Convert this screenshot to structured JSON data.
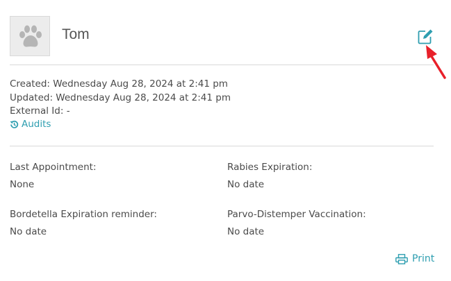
{
  "pet": {
    "name": "Tom",
    "avatar_icon": "paw-print-icon"
  },
  "header": {
    "edit_icon": "edit-icon"
  },
  "meta": {
    "created": "Created: Wednesday Aug 28, 2024 at 2:41 pm",
    "updated": "Updated: Wednesday Aug 28, 2024 at 2:41 pm",
    "external_id": "External Id: -",
    "audits_label": "Audits",
    "audits_icon": "history-icon"
  },
  "fields": {
    "last_appointment": {
      "label": "Last Appointment:",
      "value": "None"
    },
    "rabies_expiration": {
      "label": "Rabies Expiration:",
      "value": "No date"
    },
    "bordetella_reminder": {
      "label": "Bordetella Expiration reminder:",
      "value": "No date"
    },
    "parvo_distemper": {
      "label": "Parvo-Distemper Vaccination:",
      "value": "No date"
    }
  },
  "footer": {
    "print_label": "Print",
    "print_icon": "printer-icon"
  },
  "colors": {
    "link": "#2e9eb0",
    "annotation_arrow": "#e8202a"
  }
}
